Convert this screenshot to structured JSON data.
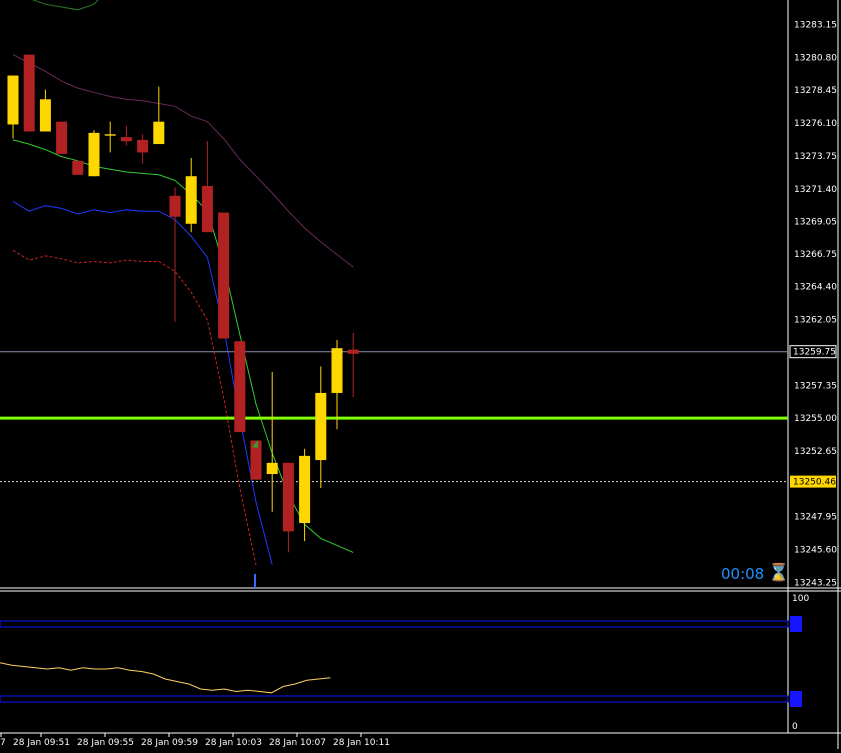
{
  "chart_data": [
    {
      "type": "candlestick",
      "symbol_timeframe": "M1",
      "price_axis_labels": [
        "13283.15",
        "13280.80",
        "13278.45",
        "13276.10",
        "13273.75",
        "13271.40",
        "13269.05",
        "13266.75",
        "13264.40",
        "13262.05",
        "13257.35",
        "13255.00",
        "13252.65",
        "13247.95",
        "13245.60",
        "13243.25"
      ],
      "ylim": [
        13243.25,
        13284.0
      ],
      "time_labels": [
        "7",
        "28 Jan 09:51",
        "28 Jan 09:55",
        "28 Jan 09:59",
        "28 Jan 10:03",
        "28 Jan 10:07",
        "28 Jan 10:11"
      ],
      "current_price_label": "13259.75",
      "current_price": 13259.75,
      "line_marker_label": "13250.46",
      "line_marker_value": 13250.46,
      "horizontal_line_value": 13255.0,
      "colors": {
        "bull": "#ffd700",
        "bear": "#b22222",
        "wick": "#ffffff"
      },
      "candles": [
        {
          "o": 13276.0,
          "h": 13278.0,
          "l": 13275.0,
          "c": 13279.5
        },
        {
          "o": 13281.0,
          "h": 13281.0,
          "l": 13275.5,
          "c": 13275.5
        },
        {
          "o": 13275.5,
          "h": 13278.5,
          "l": 13275.5,
          "c": 13277.8
        },
        {
          "o": 13276.2,
          "h": 13276.2,
          "l": 13273.9,
          "c": 13273.9
        },
        {
          "o": 13273.4,
          "h": 13273.4,
          "l": 13272.4,
          "c": 13272.4
        },
        {
          "o": 13272.3,
          "h": 13275.6,
          "l": 13272.3,
          "c": 13275.4
        },
        {
          "o": 13275.2,
          "h": 13276.2,
          "l": 13274.0,
          "c": 13275.3
        },
        {
          "o": 13275.1,
          "h": 13275.9,
          "l": 13274.5,
          "c": 13274.8
        },
        {
          "o": 13274.9,
          "h": 13275.3,
          "l": 13273.2,
          "c": 13274.0
        },
        {
          "o": 13274.6,
          "h": 13278.7,
          "l": 13274.6,
          "c": 13276.2
        },
        {
          "o": 13270.9,
          "h": 13271.5,
          "l": 13261.9,
          "c": 13269.4
        },
        {
          "o": 13268.9,
          "h": 13273.6,
          "l": 13268.3,
          "c": 13272.3
        },
        {
          "o": 13271.6,
          "h": 13274.8,
          "l": 13268.3,
          "c": 13268.3
        },
        {
          "o": 13269.7,
          "h": 13269.7,
          "l": 13260.7,
          "c": 13260.7
        },
        {
          "o": 13260.5,
          "h": 13260.5,
          "l": 13254.0,
          "c": 13254.0
        },
        {
          "o": 13253.4,
          "h": 13253.4,
          "l": 13250.6,
          "c": 13250.6
        },
        {
          "o": 13251.0,
          "h": 13258.3,
          "l": 13248.3,
          "c": 13251.8
        },
        {
          "o": 13251.8,
          "h": 13251.8,
          "l": 13245.4,
          "c": 13246.9
        },
        {
          "o": 13247.5,
          "h": 13252.8,
          "l": 13246.2,
          "c": 13252.3
        },
        {
          "o": 13252.0,
          "h": 13258.7,
          "l": 13250.0,
          "c": 13256.8
        },
        {
          "o": 13256.8,
          "h": 13260.6,
          "l": 13254.2,
          "c": 13260.0
        },
        {
          "o": 13259.9,
          "h": 13261.1,
          "l": 13256.5,
          "c": 13259.6
        }
      ],
      "lines": [
        {
          "color": "#2a7a2a",
          "values": [
            13285.5,
            13285.0,
            13284.6,
            13284.4,
            13284.2,
            13284.6,
            13285.8
          ]
        },
        {
          "color": "#6a2a5a",
          "values": [
            13281.0,
            13280.4,
            13279.8,
            13279.1,
            13278.6,
            13278.3,
            13278.0,
            13277.8,
            13277.7,
            13277.5,
            13277.3,
            13276.6,
            13276.2,
            13275.0,
            13273.5,
            13272.3,
            13271.1,
            13269.8,
            13268.6,
            13267.6,
            13266.7,
            13265.8
          ]
        },
        {
          "color": "#33cc33",
          "values": [
            13274.9,
            13274.6,
            13274.2,
            13273.7,
            13273.4,
            13273.0,
            13272.8,
            13272.6,
            13272.5,
            13272.4,
            13272.0,
            13271.0,
            13269.8,
            13266.0,
            13261.0,
            13256.0,
            13252.5,
            13249.5,
            13247.4,
            13246.4,
            13245.9,
            13245.4
          ]
        },
        {
          "color": "#1e3aff",
          "values": [
            13270.5,
            13269.8,
            13270.2,
            13270.0,
            13269.6,
            13269.9,
            13269.7,
            13269.9,
            13269.8,
            13269.8,
            13269.2,
            13268.0,
            13266.5,
            13261.5,
            13255.0,
            13249.0,
            13244.5
          ]
        },
        {
          "color": "#cc2222",
          "dashed": true,
          "values": [
            13267.0,
            13266.3,
            13266.6,
            13266.4,
            13266.1,
            13266.2,
            13266.1,
            13266.3,
            13266.2,
            13266.2,
            13265.5,
            13264.0,
            13262.0,
            13256.5,
            13250.0,
            13244.5
          ]
        }
      ]
    },
    {
      "type": "line",
      "ylim": [
        0,
        100
      ],
      "axis_labels": [
        "100",
        "0"
      ],
      "levels": [
        80,
        20
      ],
      "level_color": "#1515ff",
      "series": [
        {
          "color": "#ffd166",
          "values": [
            49,
            47,
            46,
            45,
            44,
            45,
            43,
            45,
            44,
            44,
            45,
            43,
            42,
            40,
            36,
            34,
            32,
            28,
            27,
            28,
            26,
            27,
            26,
            25,
            30,
            32,
            35,
            36,
            37
          ]
        }
      ]
    }
  ],
  "countdown": "00:08",
  "hourglass_icon": "hourglass-icon"
}
